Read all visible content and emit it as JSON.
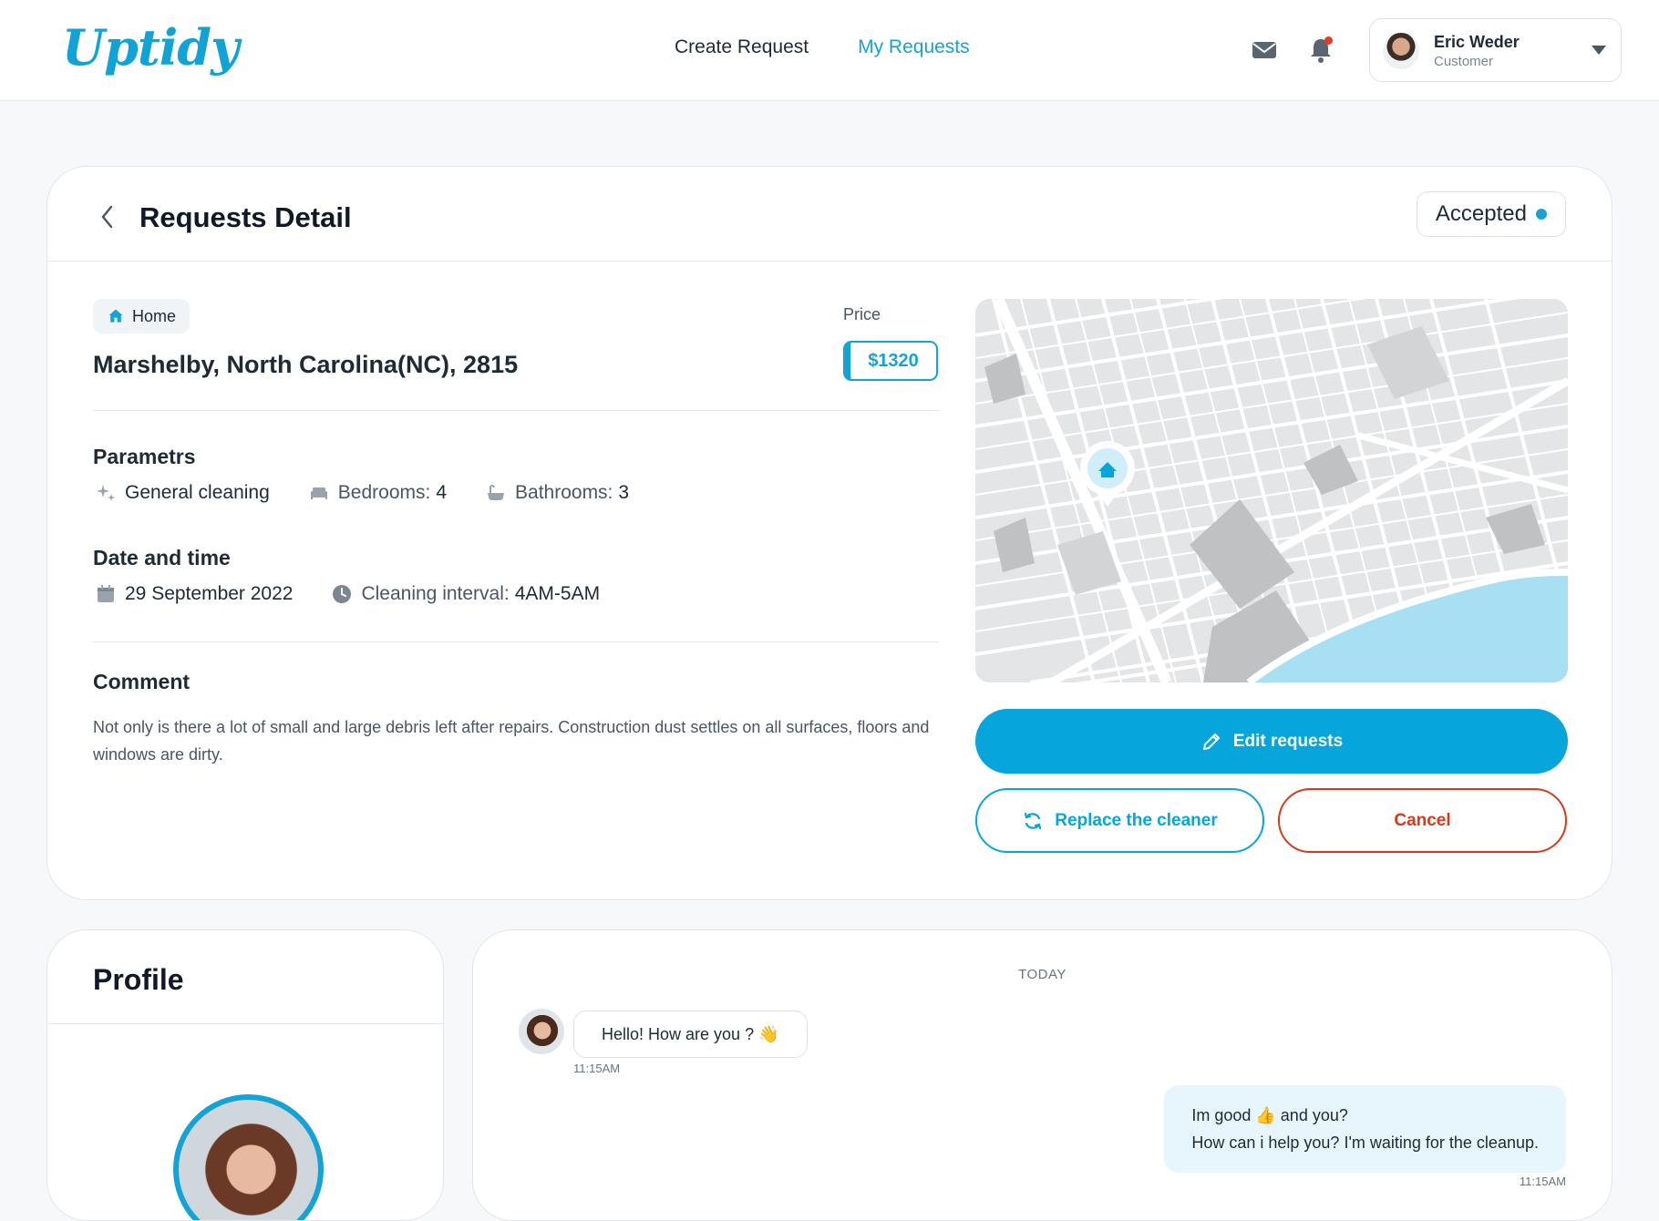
{
  "header": {
    "logo": "Uptidy",
    "nav": [
      {
        "label": "Create Request"
      },
      {
        "label": "My Requests"
      }
    ],
    "user": {
      "name": "Eric Weder",
      "role": "Customer"
    }
  },
  "request": {
    "title": "Requests Detail",
    "status": "Accepted",
    "tag": "Home",
    "address": "Marshelby, North Carolina(NC), 2815",
    "price_label": "Price",
    "price": "$1320",
    "params_title": "Parametrs",
    "params": {
      "cleaning": "General cleaning",
      "bedrooms_label": "Bedrooms:",
      "bedrooms_value": "4",
      "bathrooms_label": "Bathrooms:",
      "bathrooms_value": "3"
    },
    "datetime_title": "Date and time",
    "date": "29 September 2022",
    "interval_label": "Cleaning interval:",
    "interval_value": "4AM-5AM",
    "comment_title": "Comment",
    "comment": "Not only is there a lot of small and large debris left after repairs. Construction dust settles on all surfaces, floors and windows are dirty."
  },
  "actions": {
    "edit": "Edit requests",
    "replace": "Replace the cleaner",
    "cancel": "Cancel"
  },
  "profile": {
    "title": "Profile"
  },
  "chat": {
    "day": "TODAY",
    "messages": [
      {
        "text": "Hello! How are you ? 👋",
        "time": "11:15AM"
      },
      {
        "line1": "Im good 👍 and you?",
        "line2": "How can i help you? I'm waiting for the cleanup.",
        "time": "11:15AM"
      }
    ]
  },
  "colors": {
    "accent": "#06a6dc",
    "danger": "#d63a1c",
    "text": "#1f2a37"
  }
}
